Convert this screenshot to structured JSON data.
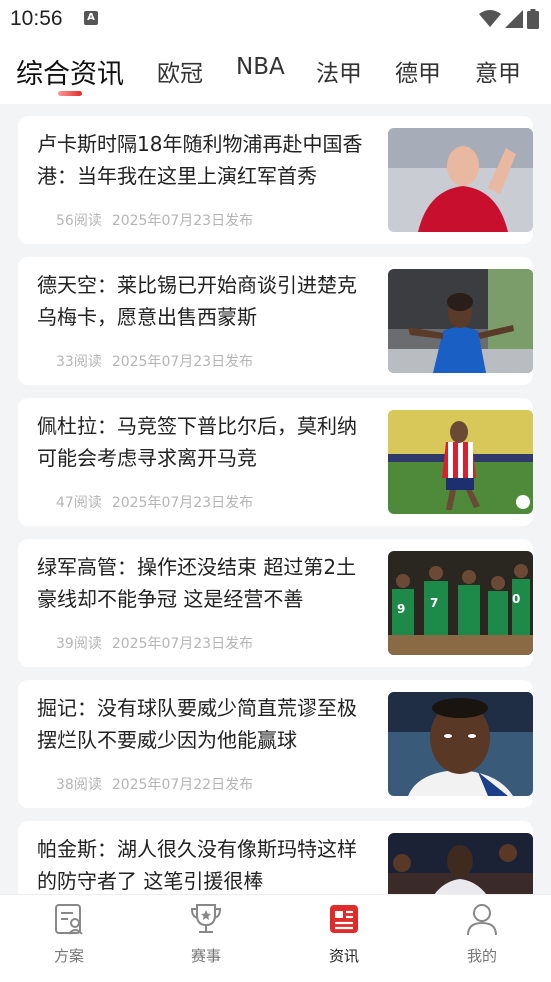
{
  "status_bar": {
    "time": "10:56",
    "notification_icon": "a-icon",
    "icons": [
      "wifi-icon",
      "signal-icon",
      "battery-icon"
    ]
  },
  "tabs": [
    {
      "label": "综合资讯",
      "active": true
    },
    {
      "label": "欧冠",
      "active": false
    },
    {
      "label": "NBA",
      "active": false
    },
    {
      "label": "法甲",
      "active": false
    },
    {
      "label": "德甲",
      "active": false
    },
    {
      "label": "意甲",
      "active": false
    }
  ],
  "accent_color": "#e02b2b",
  "articles": [
    {
      "title": "卢卡斯时隔18年随利物浦再赴中国香港：当年我在这里上演红军首秀",
      "reads": "56阅读",
      "date": "2025年07月23日发布",
      "image": "liverpool-player-applauding"
    },
    {
      "title": "德天空：莱比锡已开始商谈引进楚克乌梅卡，愿意出售西蒙斯",
      "reads": "33阅读",
      "date": "2025年07月23日发布",
      "image": "chelsea-player-in-blue"
    },
    {
      "title": "佩杜拉：马竞签下普比尔后，莫利纳可能会考虑寻求离开马竞",
      "reads": "47阅读",
      "date": "2025年07月23日发布",
      "image": "atletico-player-running"
    },
    {
      "title": "绿军高管：操作还没结束 超过第2土豪线却不能争冠 这是经营不善",
      "reads": "39阅读",
      "date": "2025年07月23日发布",
      "image": "celtics-players-on-court"
    },
    {
      "title": "掘记：没有球队要威少简直荒谬至极 摆烂队不要威少因为他能赢球",
      "reads": "38阅读",
      "date": "2025年07月22日发布",
      "image": "westbrook-close-up"
    },
    {
      "title": "帕金斯：湖人很久没有像斯玛特这样的防守者了 这笔引援很棒",
      "reads": "",
      "date": "",
      "image": "wizards-player"
    }
  ],
  "bottom_nav": [
    {
      "label": "方案",
      "icon": "plan-icon",
      "active": false
    },
    {
      "label": "赛事",
      "icon": "trophy-icon",
      "active": false
    },
    {
      "label": "资讯",
      "icon": "news-icon",
      "active": true
    },
    {
      "label": "我的",
      "icon": "user-icon",
      "active": false
    }
  ]
}
